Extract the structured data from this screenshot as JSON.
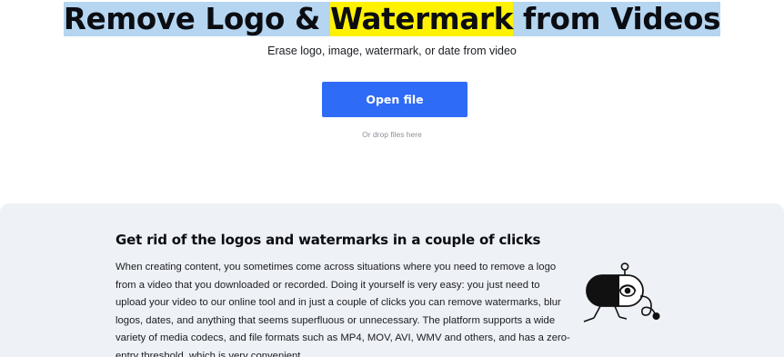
{
  "hero": {
    "title_part1": "Remove Logo & ",
    "title_highlight": "Watermark",
    "title_part2": " from Videos",
    "subtitle": "Erase logo, image, watermark, or date from video",
    "open_file_label": "Open file",
    "drop_hint": "Or drop files here"
  },
  "info": {
    "heading": "Get rid of the logos and watermarks in a couple of clicks",
    "body_lines": [
      "When creating content, you sometimes come across situations where you need to remove a logo",
      "from a video that you downloaded or recorded. Doing it yourself is very easy: you just need to",
      "upload your video to our online tool and in just a couple of clicks you can remove watermarks, blur",
      "logos, dates, and anything that seems superfluous or unnecessary. The platform supports a wide",
      "variety of media codecs, and file formats such as MP4, MOV, AVI, WMV and others, and has a zero-",
      "entry threshold, which is very convenient."
    ]
  },
  "colors": {
    "accent_button": "#2e6bf6",
    "title_highlight": "#fff200",
    "text_selection": "#b5d5f0",
    "section_background": "#eef1f5"
  },
  "icons": {
    "illustration": "pill-character-illustration"
  }
}
